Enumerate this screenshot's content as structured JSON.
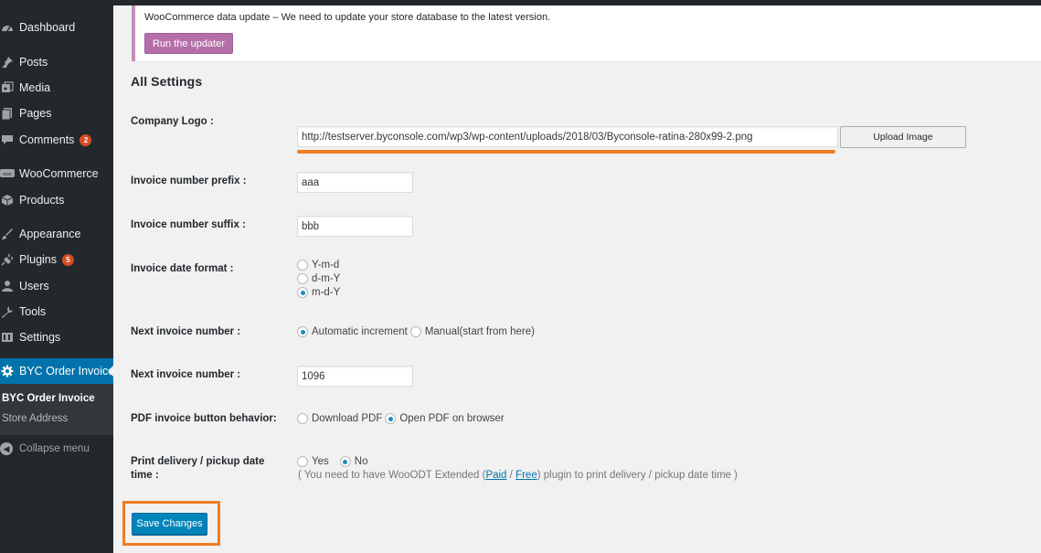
{
  "sidebar": {
    "items": [
      {
        "label": "Dashboard",
        "icon": "dashboard-icon"
      },
      {
        "label": "Posts",
        "icon": "pin-icon"
      },
      {
        "label": "Media",
        "icon": "media-icon"
      },
      {
        "label": "Pages",
        "icon": "pages-icon"
      },
      {
        "label": "Comments",
        "icon": "comment-icon",
        "badge": "2"
      },
      {
        "label": "WooCommerce",
        "icon": "woo-icon"
      },
      {
        "label": "Products",
        "icon": "box-icon"
      },
      {
        "label": "Appearance",
        "icon": "brush-icon"
      },
      {
        "label": "Plugins",
        "icon": "plug-icon",
        "badge": "5"
      },
      {
        "label": "Users",
        "icon": "user-icon"
      },
      {
        "label": "Tools",
        "icon": "wrench-icon"
      },
      {
        "label": "Settings",
        "icon": "settings-icon"
      },
      {
        "label": "BYC Order Invoice",
        "icon": "gear-icon"
      }
    ],
    "submenu": [
      "BYC Order Invoice",
      "Store Address"
    ],
    "collapse_label": "Collapse menu"
  },
  "notice": {
    "text": "WooCommerce data update – We need to update your store database to the latest version.",
    "button": "Run the updater"
  },
  "settings": {
    "heading": "All Settings",
    "company_logo": {
      "label": "Company Logo :",
      "value": "http://testserver.byconsole.com/wp3/wp-content/uploads/2018/03/Byconsole-ratina-280x99-2.png",
      "upload_button": "Upload Image"
    },
    "prefix": {
      "label": "Invoice number prefix :",
      "value": "aaa"
    },
    "suffix": {
      "label": "Invoice number suffix :",
      "value": "bbb"
    },
    "date_format": {
      "label": "Invoice date format :",
      "options": [
        "Y-m-d",
        "d-m-Y",
        "m-d-Y"
      ],
      "selected": "m-d-Y"
    },
    "next_number_mode": {
      "label": "Next invoice number :",
      "options": [
        "Automatic increment",
        "Manual(start from here)"
      ],
      "selected": "Automatic increment"
    },
    "next_number": {
      "label": "Next invoice number :",
      "value": "1096"
    },
    "pdf_behavior": {
      "label": "PDF invoice button behavior:",
      "options": [
        "Download PDF",
        "Open PDF on browser"
      ],
      "selected": "Open PDF on browser"
    },
    "print_delivery": {
      "label_line1": "Print delivery / pickup date",
      "label_line2": "time :",
      "options": [
        "Yes",
        "No"
      ],
      "selected": "No",
      "note_prefix": "( You need to have WooODT Extended (",
      "note_link_paid": "Paid",
      "note_sep": " / ",
      "note_link_free": "Free",
      "note_suffix": ") plugin to print delivery / pickup date time )"
    },
    "save_button": "Save Changes"
  },
  "colors": {
    "sidebar_bg": "#23282d",
    "active_menu": "#0073aa",
    "highlight": "#ef7d22",
    "woo_purple": "#b56fa8",
    "primary_button": "#0085ba"
  }
}
